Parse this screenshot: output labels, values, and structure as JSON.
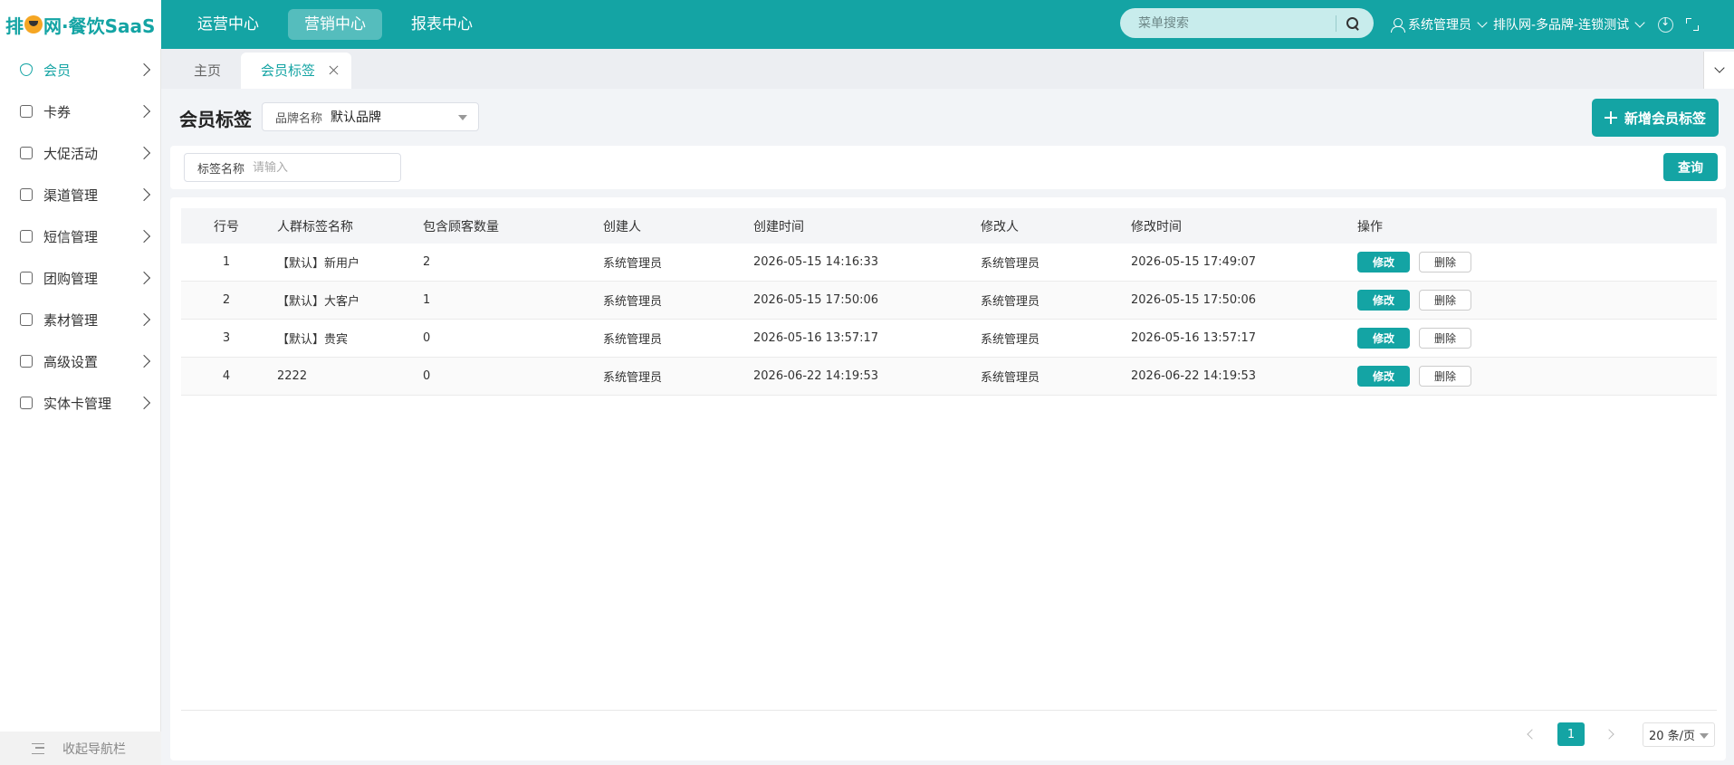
{
  "app": {
    "logo": {
      "before": "排",
      "after": "网·餐饮SaaS"
    },
    "main_nav": [
      {
        "label": "运营中心",
        "active": false
      },
      {
        "label": "营销中心",
        "active": true
      },
      {
        "label": "报表中心",
        "active": false
      }
    ],
    "search": {
      "placeholder": "菜单搜索"
    },
    "user": {
      "name": "系统管理员"
    },
    "store": {
      "name": "排队网-多品牌-连锁测试"
    }
  },
  "sidebar": {
    "items": [
      {
        "label": "会员",
        "icon": "member-icon",
        "active": true
      },
      {
        "label": "卡券",
        "icon": "coupon-icon"
      },
      {
        "label": "大促活动",
        "icon": "gift-icon"
      },
      {
        "label": "渠道管理",
        "icon": "layers-icon"
      },
      {
        "label": "短信管理",
        "icon": "message-icon"
      },
      {
        "label": "团购管理",
        "icon": "groupbuy-icon"
      },
      {
        "label": "素材管理",
        "icon": "material-icon"
      },
      {
        "label": "高级设置",
        "icon": "settings-icon"
      },
      {
        "label": "实体卡管理",
        "icon": "card-icon"
      }
    ],
    "collapse_label": "收起导航栏"
  },
  "tabs": [
    {
      "label": "主页",
      "active": false
    },
    {
      "label": "会员标签",
      "active": true
    }
  ],
  "page": {
    "title": "会员标签",
    "brand_select": {
      "label": "品牌名称",
      "value": "默认品牌"
    },
    "add_button": "新增会员标签"
  },
  "filter": {
    "tag_name_label": "标签名称",
    "tag_name_placeholder": "请输入",
    "query_button": "查询"
  },
  "table": {
    "columns": [
      "行号",
      "人群标签名称",
      "包含顾客数量",
      "创建人",
      "创建时间",
      "修改人",
      "修改时间",
      "操作"
    ],
    "rows": [
      {
        "no": "1",
        "name": "【默认】新用户",
        "count": "2",
        "creator": "系统管理员",
        "created": "2026-05-15 14:16:33",
        "modifier": "系统管理员",
        "modified": "2026-05-15 17:49:07"
      },
      {
        "no": "2",
        "name": "【默认】大客户",
        "count": "1",
        "creator": "系统管理员",
        "created": "2026-05-15 17:50:06",
        "modifier": "系统管理员",
        "modified": "2026-05-15 17:50:06"
      },
      {
        "no": "3",
        "name": "【默认】贵宾",
        "count": "0",
        "creator": "系统管理员",
        "created": "2026-05-16 13:57:17",
        "modifier": "系统管理员",
        "modified": "2026-05-16 13:57:17"
      },
      {
        "no": "4",
        "name": "2222",
        "count": "0",
        "creator": "系统管理员",
        "created": "2026-06-22 14:19:53",
        "modifier": "系统管理员",
        "modified": "2026-06-22 14:19:53"
      }
    ],
    "edit_label": "修改",
    "delete_label": "删除"
  },
  "pagination": {
    "current_page": "1",
    "page_size": "20 条/页"
  },
  "colors": {
    "primary": "#14a4a4"
  }
}
